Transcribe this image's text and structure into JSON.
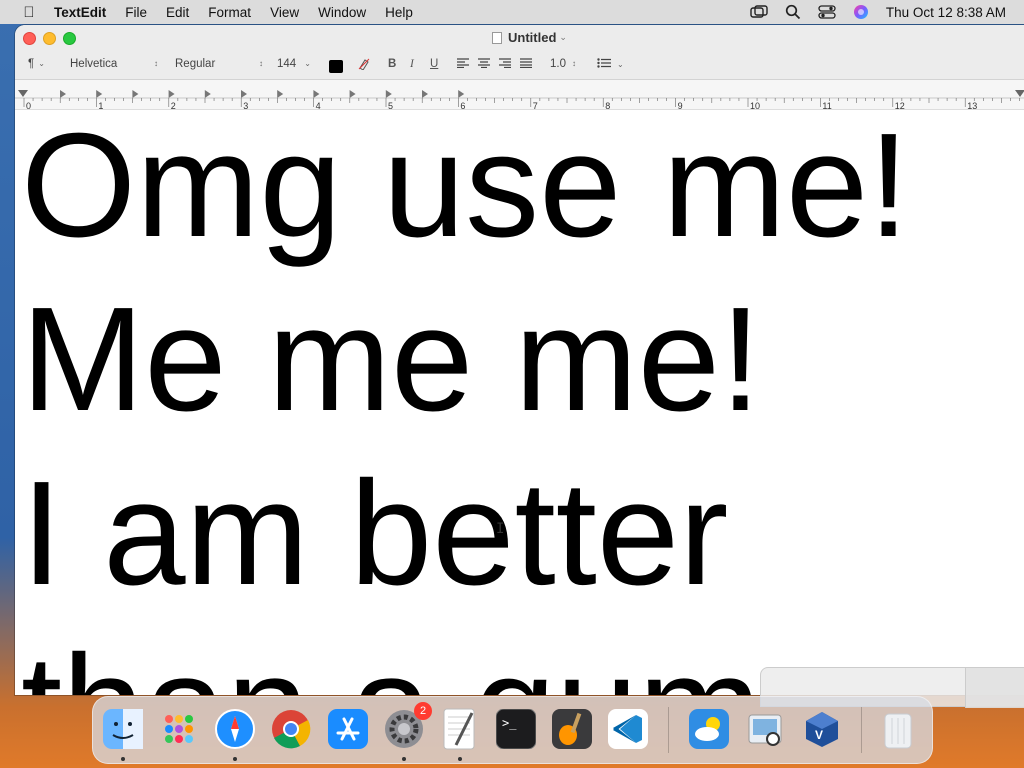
{
  "menubar": {
    "app_name": "TextEdit",
    "menus": [
      "File",
      "Edit",
      "Format",
      "View",
      "Window",
      "Help"
    ],
    "clock": "Thu Oct 12  8:38 AM"
  },
  "window": {
    "title": "Untitled"
  },
  "toolbar": {
    "paragraph_style": "¶",
    "font_family": "Helvetica",
    "font_style": "Regular",
    "font_size": "144",
    "bold": "B",
    "italic": "I",
    "underline": "U",
    "line_spacing": "1.0",
    "text_color": "#000000"
  },
  "ruler": {
    "numbers": [
      "0",
      "1",
      "2",
      "3",
      "4",
      "5",
      "6",
      "7",
      "8",
      "9",
      "10",
      "11",
      "12",
      "13"
    ]
  },
  "document": {
    "lines": [
      "Omg use me!",
      "Me me me!",
      "I am better",
      "than a gum"
    ]
  },
  "dock": {
    "apps": [
      {
        "name": "Finder",
        "icon": "finder-icon",
        "color": "#3d8df0",
        "running": true
      },
      {
        "name": "Launchpad",
        "icon": "launchpad-icon",
        "color": "#e9e9ee",
        "running": false
      },
      {
        "name": "Safari",
        "icon": "safari-icon",
        "color": "#1e90ff",
        "running": true
      },
      {
        "name": "Chrome",
        "icon": "chrome-icon",
        "color": "#ffffff",
        "running": false
      },
      {
        "name": "App Store",
        "icon": "app-store-icon",
        "color": "#1a8cff",
        "running": false
      },
      {
        "name": "System Settings",
        "icon": "gear-icon",
        "color": "#8e8e93",
        "running": true,
        "badge": "2"
      },
      {
        "name": "TextEdit",
        "icon": "textedit-icon",
        "color": "#f4f4f4",
        "running": true
      },
      {
        "name": "Terminal",
        "icon": "terminal-icon",
        "color": "#1c1c1e",
        "running": false
      },
      {
        "name": "GarageBand",
        "icon": "guitar-icon",
        "color": "#3a3a3c",
        "running": false
      },
      {
        "name": "VS Code",
        "icon": "vscode-icon",
        "color": "#ffffff",
        "running": false
      },
      {
        "name": "Weather",
        "icon": "weather-icon",
        "color": "#2f8de4",
        "running": false
      },
      {
        "name": "Preview",
        "icon": "preview-icon",
        "color": "#dfe6ee",
        "running": false
      },
      {
        "name": "VirtualBox",
        "icon": "virtualbox-icon",
        "color": "#1f4f9a",
        "running": false
      },
      {
        "name": "Trash",
        "icon": "trash-icon",
        "color": "#e6e8ec",
        "running": false
      }
    ]
  }
}
